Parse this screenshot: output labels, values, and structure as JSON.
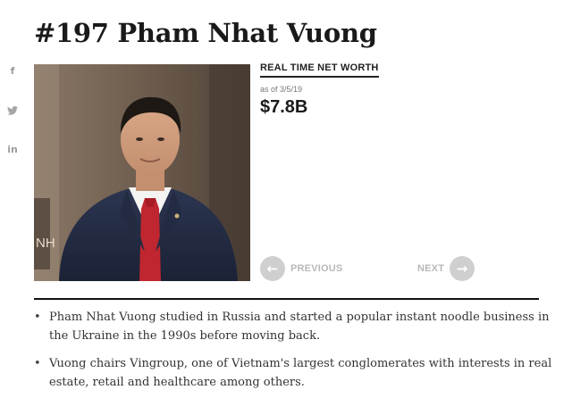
{
  "profile": {
    "title": "#197 Pham Nhat Vuong"
  },
  "social": [
    {
      "icon": "facebook-icon",
      "glyph": "f"
    },
    {
      "icon": "twitter-icon",
      "glyph": "❧"
    },
    {
      "icon": "linkedin-icon",
      "glyph": "in"
    }
  ],
  "networth": {
    "label": "REAL TIME NET WORTH",
    "date": "as of 3/5/19",
    "value": "$7.8B"
  },
  "photo": {
    "wall_text": "NH"
  },
  "nav": {
    "prev_label": "PREVIOUS",
    "next_label": "NEXT",
    "prev_icon": "arrow-left-icon",
    "next_icon": "arrow-right-icon"
  },
  "bullets": [
    "Pham Nhat Vuong studied in Russia and started a popular instant noodle business in the Ukraine in the 1990s before moving back.",
    "Vuong chairs Vingroup, one of Vietnam's largest conglomerates with interests in real estate, retail and healthcare among others."
  ]
}
